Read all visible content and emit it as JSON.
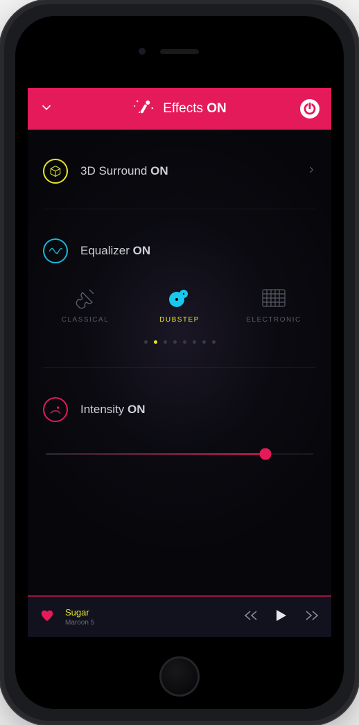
{
  "header": {
    "title_prefix": "Effects ",
    "title_state": "ON"
  },
  "surround": {
    "label_prefix": "3D Surround ",
    "state": "ON"
  },
  "equalizer": {
    "label_prefix": "Equalizer ",
    "state": "ON",
    "presets": {
      "left": "CLASSICAL",
      "center": "DUBSTEP",
      "right": "ELECTRONIC"
    },
    "page_count": 8,
    "active_page": 1
  },
  "intensity": {
    "label_prefix": "Intensity ",
    "state": "ON",
    "value_percent": 82
  },
  "now_playing": {
    "title": "Sugar",
    "artist": "Maroon 5"
  }
}
